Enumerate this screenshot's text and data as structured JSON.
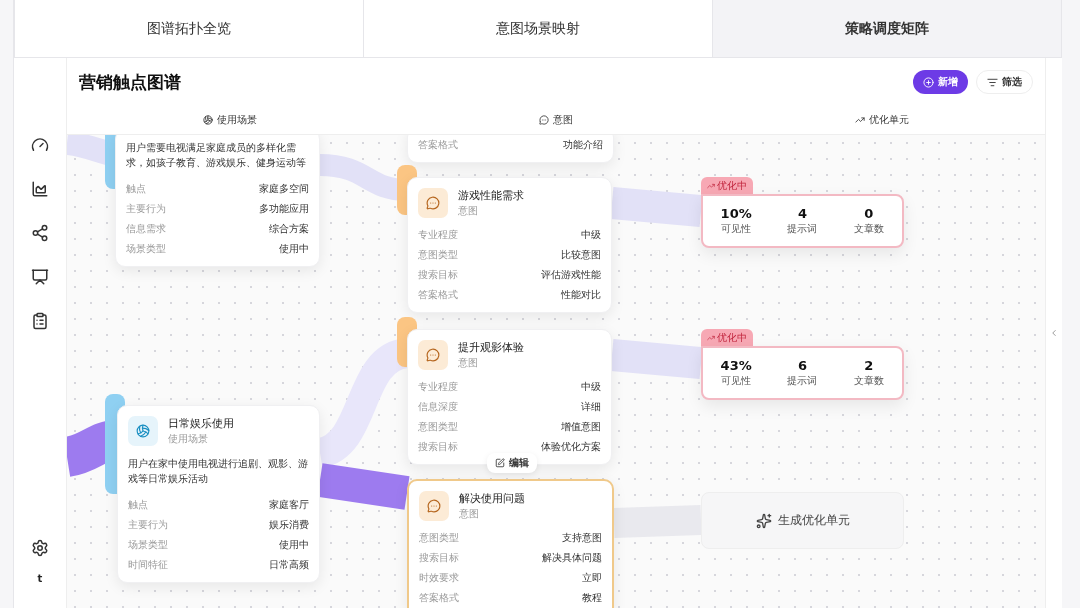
{
  "tabs": [
    {
      "label": "图谱拓扑全览",
      "selected": false
    },
    {
      "label": "意图场景映射",
      "selected": false
    },
    {
      "label": "策略调度矩阵",
      "selected": true
    }
  ],
  "title": "营销触点图谱",
  "actions": [
    {
      "kind": "primary",
      "label": "新增"
    },
    {
      "kind": "secondary",
      "label": "筛选"
    }
  ],
  "columns": [
    {
      "kind": "scenario",
      "label": "使用场景"
    },
    {
      "kind": "intent",
      "label": "意图"
    },
    {
      "kind": "unit",
      "label": "优化单元"
    }
  ],
  "scenarios": [
    {
      "description": "用户需要电视满足家庭成员的多样化需求，如孩子教育、游戏娱乐、健身运动等",
      "rows": [
        {
          "label": "触点",
          "value": "家庭多空间"
        },
        {
          "label": "主要行为",
          "value": "多功能应用"
        },
        {
          "label": "信息需求",
          "value": "综合方案"
        },
        {
          "label": "场景类型",
          "value": "使用中"
        }
      ]
    },
    {
      "title": "日常娱乐使用",
      "subtitle": "使用场景",
      "description": "用户在家中使用电视进行追剧、观影、游戏等日常娱乐活动",
      "rows": [
        {
          "label": "触点",
          "value": "家庭客厅"
        },
        {
          "label": "主要行为",
          "value": "娱乐消费"
        },
        {
          "label": "场景类型",
          "value": "使用中"
        },
        {
          "label": "时间特征",
          "value": "日常高频"
        }
      ]
    }
  ],
  "intents": [
    {
      "selected": false,
      "rows": [
        {
          "label": "答案格式",
          "value": "功能介绍"
        }
      ]
    },
    {
      "title": "游戏性能需求",
      "subtitle": "意图",
      "selected": false,
      "rows": [
        {
          "label": "专业程度",
          "value": "中级"
        },
        {
          "label": "意图类型",
          "value": "比较意图"
        },
        {
          "label": "搜索目标",
          "value": "评估游戏性能"
        },
        {
          "label": "答案格式",
          "value": "性能对比"
        }
      ]
    },
    {
      "title": "提升观影体验",
      "subtitle": "意图",
      "selected": false,
      "rows": [
        {
          "label": "专业程度",
          "value": "中级"
        },
        {
          "label": "信息深度",
          "value": "详细"
        },
        {
          "label": "意图类型",
          "value": "增值意图"
        },
        {
          "label": "搜索目标",
          "value": "体验优化方案"
        }
      ]
    },
    {
      "title": "解决使用问题",
      "subtitle": "意图",
      "selected": true,
      "rows": [
        {
          "label": "意图类型",
          "value": "支持意图"
        },
        {
          "label": "搜索目标",
          "value": "解决具体问题"
        },
        {
          "label": "时效要求",
          "value": "立即"
        },
        {
          "label": "答案格式",
          "value": "教程"
        }
      ]
    }
  ],
  "edit_button": "编辑",
  "units": [
    {
      "status": "优化中",
      "metrics": [
        {
          "value": "10%",
          "label": "可见性"
        },
        {
          "value": "4",
          "label": "提示词"
        },
        {
          "value": "0",
          "label": "文章数"
        }
      ]
    },
    {
      "status": "优化中",
      "metrics": [
        {
          "value": "43%",
          "label": "可见性"
        },
        {
          "value": "6",
          "label": "提示词"
        },
        {
          "value": "2",
          "label": "文章数"
        }
      ]
    }
  ],
  "generate_button": "生成优化单元",
  "avatar": "t"
}
